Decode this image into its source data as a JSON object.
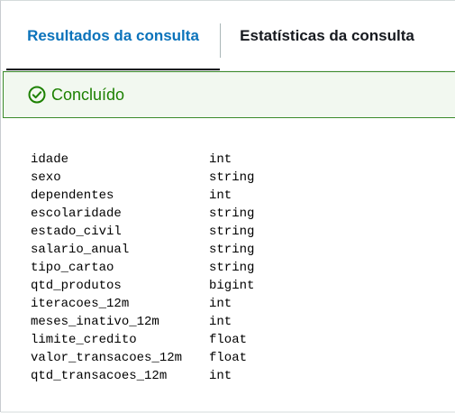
{
  "tabs": {
    "active": {
      "label": "Resultados da consulta"
    },
    "inactive": {
      "label": "Estatísticas da consulta"
    }
  },
  "status": {
    "icon": "check-circle-icon",
    "text": "Concluído",
    "color": "#1d8102"
  },
  "schema": {
    "rows": [
      {
        "name": "idade",
        "type": "int"
      },
      {
        "name": "sexo",
        "type": "string"
      },
      {
        "name": "dependentes",
        "type": "int"
      },
      {
        "name": "escolaridade",
        "type": "string"
      },
      {
        "name": "estado_civil",
        "type": "string"
      },
      {
        "name": "salario_anual",
        "type": "string"
      },
      {
        "name": "tipo_cartao",
        "type": "string"
      },
      {
        "name": "qtd_produtos",
        "type": "bigint"
      },
      {
        "name": "iteracoes_12m",
        "type": "int"
      },
      {
        "name": "meses_inativo_12m",
        "type": "int"
      },
      {
        "name": "limite_credito",
        "type": "float"
      },
      {
        "name": "valor_transacoes_12m",
        "type": "float"
      },
      {
        "name": "qtd_transacoes_12m",
        "type": "int"
      }
    ]
  },
  "colors": {
    "active_tab": "#0b73bb",
    "success_border": "#3a8a2a",
    "success_bg": "#f2f8f0"
  }
}
